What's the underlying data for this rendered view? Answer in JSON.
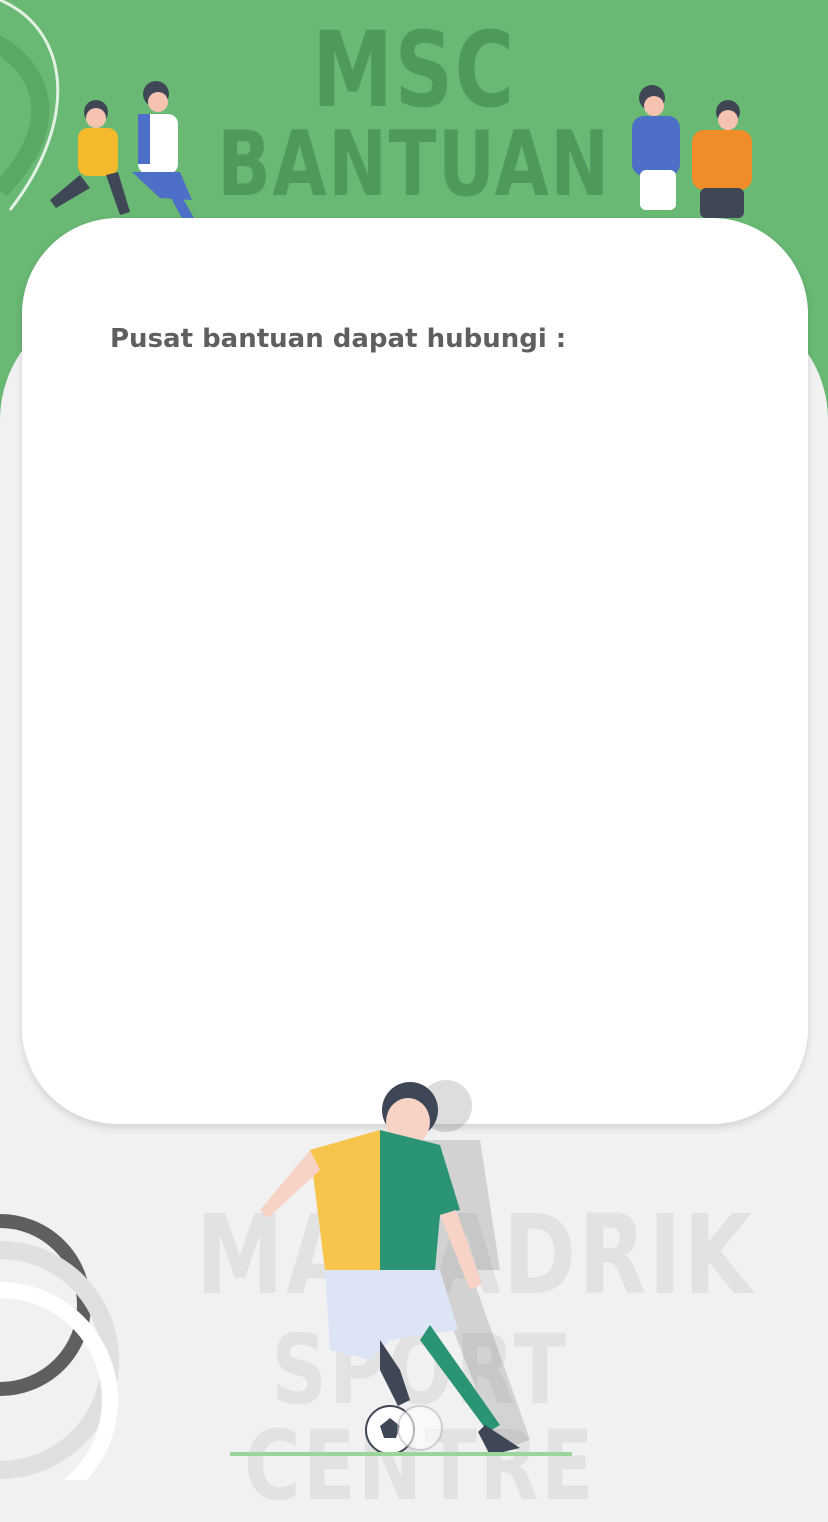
{
  "header": {
    "title_line_1": "MSC",
    "title_line_2": "BANTUAN"
  },
  "card": {
    "help_text": "Pusat bantuan dapat hubungi :"
  },
  "footer": {
    "watermark_line_1": "MAHADRIK",
    "watermark_line_2": "SPORT CENTRE"
  },
  "colors": {
    "header_green": "#69b873",
    "card_bg": "#ffffff",
    "page_bg": "#f1f1f1"
  },
  "icons": [
    "soccer-players-illustration",
    "soccer-ball-icon"
  ]
}
